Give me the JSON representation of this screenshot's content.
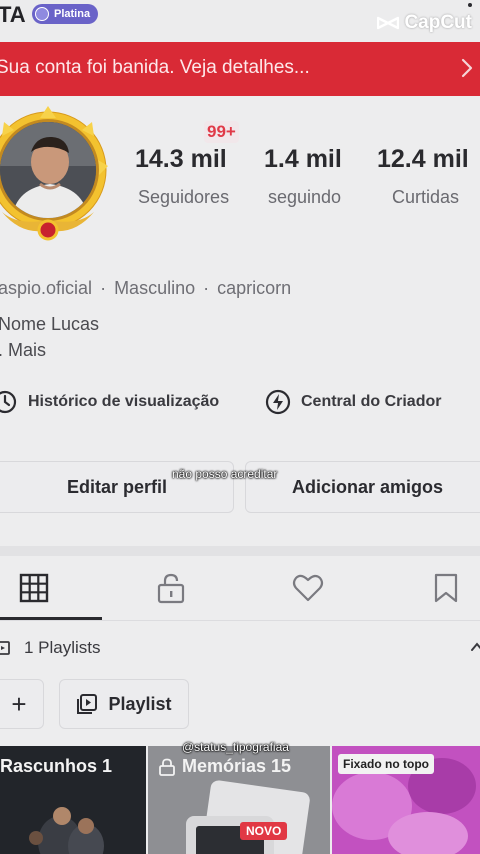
{
  "header": {
    "username_fragment": "TA",
    "badge": "Platina",
    "watermark": "CapCut"
  },
  "banner": {
    "text": "Sua conta foi banida. Veja detalhes..."
  },
  "notifications": "99+",
  "stats": [
    {
      "value": "14.3 mil",
      "label": "Seguidores"
    },
    {
      "value": "1.4 mil",
      "label": "seguindo"
    },
    {
      "value": "12.4 mil",
      "label": "Curtidas"
    }
  ],
  "info": {
    "handle": "aspio.oficial",
    "gender": "Masculino",
    "sign": "capricorn",
    "separator": "·"
  },
  "bio": {
    "line1": "Nome Lucas",
    "line2": ". Mais"
  },
  "quick_links": {
    "history": "Histórico de visualização",
    "creator": "Central do Criador"
  },
  "buttons": {
    "edit": "Editar perfil",
    "add_friends": "Adicionar amigos"
  },
  "overlays": {
    "caption": "não posso acreditar",
    "credit": "@status_tipografiaa"
  },
  "playlists": {
    "count_label": "1 Playlists",
    "add": "+",
    "playlist_button": "Playlist"
  },
  "tiles": [
    {
      "label": "Rascunhos 1"
    },
    {
      "label": "Memórias 15",
      "tag": "NOVO"
    },
    {
      "tag": "Fixado no topo"
    }
  ],
  "colors": {
    "banner": "#d92a36",
    "badge": "#6a63c8",
    "notif": "#e03a48"
  }
}
